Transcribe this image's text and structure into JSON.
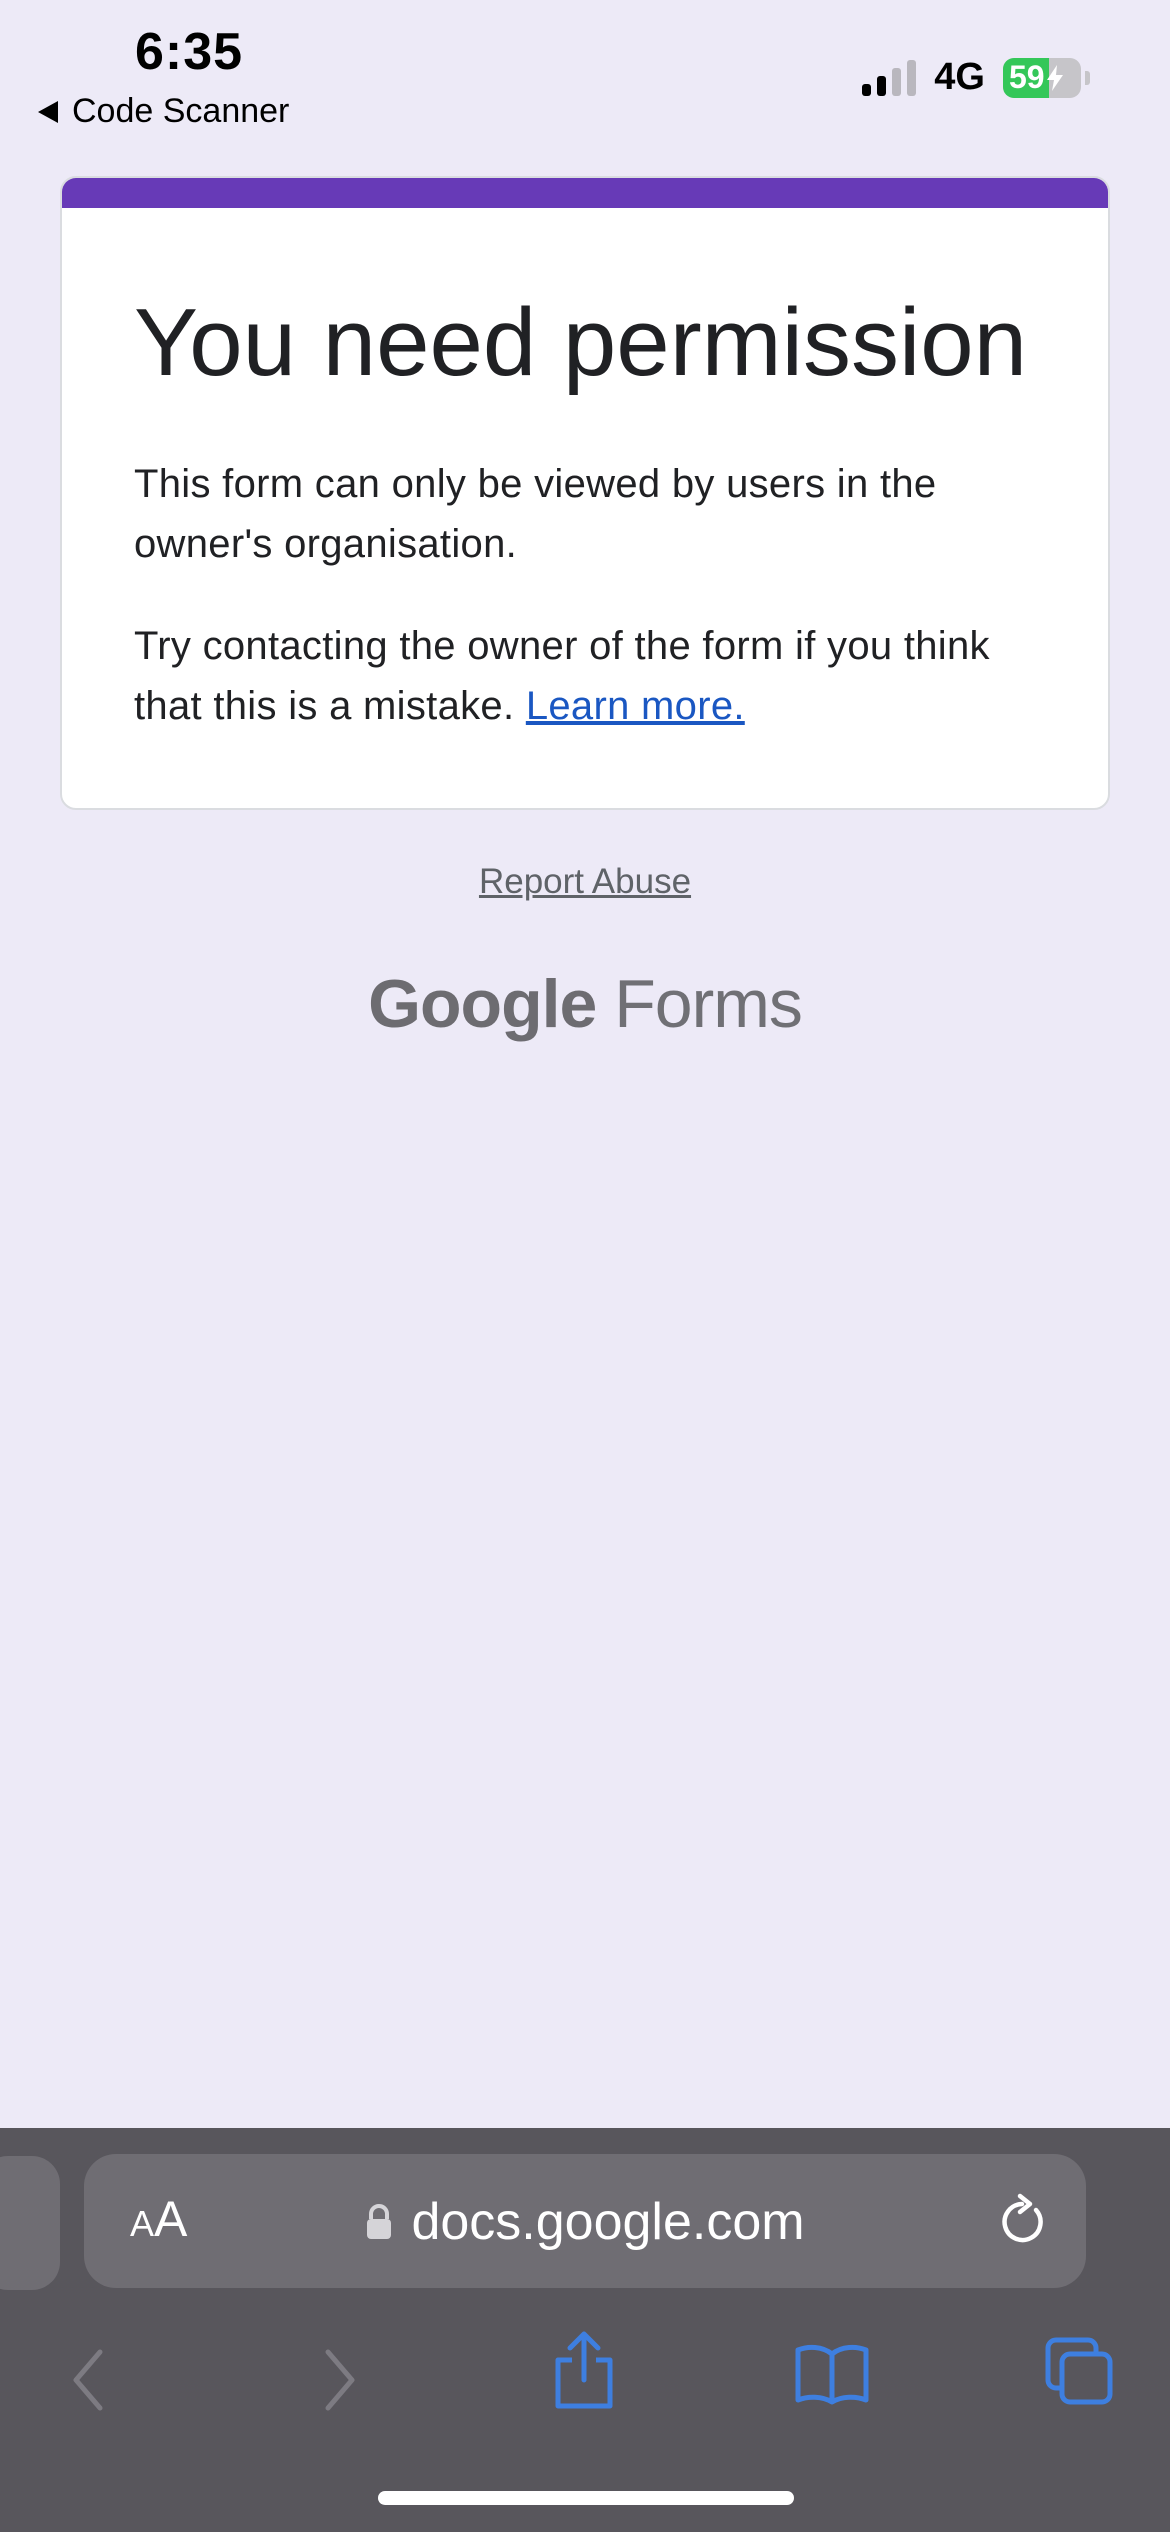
{
  "status_bar": {
    "time": "6:35",
    "back_app": "Code Scanner",
    "network": "4G",
    "battery": "59",
    "battery_level": 0.59,
    "signal_bars_active": 2,
    "signal_bars_total": 4
  },
  "card": {
    "accent_color": "#673ab7",
    "title": "You need permission",
    "paragraph1": "This form can only be viewed by users in the owner's organisation.",
    "paragraph2": "Try contacting the owner of the form if you think that this is a mistake.",
    "learn_more": "Learn more."
  },
  "footer": {
    "report_abuse": "Report Abuse",
    "brand_google": "Google",
    "brand_product": "Forms"
  },
  "browser": {
    "text_size_button": "AA",
    "url": "docs.google.com",
    "icons": [
      "lock-icon",
      "reload-icon",
      "back-icon",
      "forward-icon",
      "share-icon",
      "bookmarks-icon",
      "tabs-icon"
    ],
    "accent": "#3e7fe0"
  }
}
